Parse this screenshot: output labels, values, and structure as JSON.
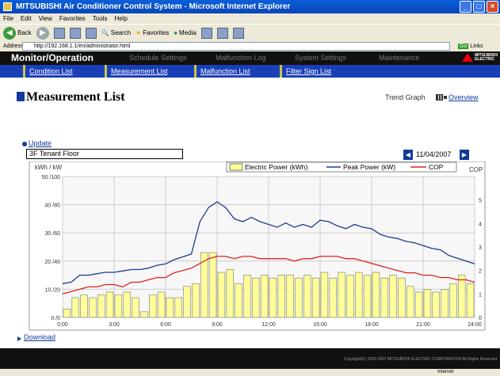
{
  "browser": {
    "title": "MITSUBISHI Air Conditioner Control System - Microsoft Internet Explorer",
    "menu": [
      "File",
      "Edit",
      "View",
      "Favorites",
      "Tools",
      "Help"
    ],
    "toolbar": {
      "back": "Back",
      "search": "Search",
      "favorites": "Favorites",
      "media": "Media"
    },
    "address_label": "Address",
    "address": "http://192.168.1.1/en/administrator.html",
    "go": "Go",
    "links": "Links",
    "status_zone": "Internet"
  },
  "nav": {
    "items": [
      "Monitor/Operation",
      "Schedule Settings",
      "Malfunction Log",
      "System Settings",
      "Maintenance"
    ]
  },
  "logo": {
    "line1": "MITSUBISHI",
    "line2": "ELECTRIC"
  },
  "subnav": {
    "items": [
      "Condition List",
      "Measurement List",
      "Malfunction List",
      "Filter Sign List"
    ]
  },
  "page": {
    "title": "Measurement List",
    "trend_label": "Trend Graph",
    "trend_link": "Overview",
    "update": "Update",
    "floor": "3F Tenant Floor",
    "date": "11/04/2007",
    "download": "Download",
    "copyright": "Copyright(C) 2002-2007 MITSUBISHI ELECTRIC CORPORATION All Rights Reserved"
  },
  "colors": {
    "bar_fill": "#ffff99",
    "bar_stroke": "#777777",
    "peak_line": "#1f3a93",
    "cop_line": "#e02020",
    "nav_bg": "#111111",
    "subnav_bg": "#1a3fb8"
  },
  "chart_data": {
    "type": "bar",
    "ylabel_left": "kWh / kW",
    "ylabel_right": "COP",
    "left_ticks": [
      "0 /0",
      "10 /20",
      "20 /40",
      "30 /60",
      "40 /80",
      "50 /100"
    ],
    "right_ticks": [
      "0",
      "1",
      "2",
      "3",
      "4",
      "5"
    ],
    "x_ticks": [
      "0:00",
      "3:00",
      "6:00",
      "9:00",
      "12:00",
      "15:00",
      "18:00",
      "21:00",
      "24:00"
    ],
    "legend": [
      "Electric Power (kWh)",
      "Peak Power (kW)",
      "COP"
    ],
    "ylim_energy": [
      0,
      50
    ],
    "ylim_power": [
      0,
      100
    ],
    "ylim_cop": [
      0,
      6
    ],
    "grid": true,
    "legend_position": "top",
    "series": [
      {
        "name": "Electric Power (kWh)",
        "type": "bar",
        "x": [
          0,
          1,
          2,
          3,
          4,
          5,
          6,
          7,
          8,
          9,
          10,
          11,
          12,
          13,
          14,
          15,
          16,
          17,
          18,
          19,
          20,
          21,
          22,
          23,
          24,
          25,
          26,
          27,
          28,
          29,
          30,
          31,
          32,
          33,
          34,
          35,
          36,
          37,
          38,
          39,
          40,
          41,
          42,
          43,
          44,
          45,
          46,
          47
        ],
        "values": [
          3,
          7,
          8,
          7,
          8,
          9,
          8,
          9,
          7,
          2,
          8,
          9,
          7,
          7,
          11,
          12,
          23,
          23,
          16,
          17,
          12,
          15,
          14,
          15,
          14,
          15,
          15,
          14,
          15,
          14,
          16,
          14,
          16,
          15,
          16,
          15,
          16,
          14,
          15,
          14,
          11,
          9,
          10,
          9,
          10,
          12,
          15,
          12
        ]
      },
      {
        "name": "Peak Power (kW)",
        "type": "line",
        "values": [
          24,
          25,
          30,
          30,
          31,
          32,
          32,
          33,
          34,
          34,
          35,
          37,
          38,
          41,
          43,
          45,
          68,
          78,
          82,
          78,
          70,
          68,
          71,
          68,
          66,
          64,
          67,
          64,
          66,
          64,
          69,
          68,
          65,
          63,
          66,
          64,
          63,
          59,
          57,
          56,
          54,
          53,
          51,
          49,
          48,
          44,
          42,
          40,
          38
        ]
      },
      {
        "name": "COP",
        "type": "line",
        "values": [
          1.0,
          1.1,
          1.2,
          1.3,
          1.3,
          1.4,
          1.4,
          1.3,
          1.5,
          1.5,
          1.6,
          1.7,
          1.7,
          1.9,
          2.0,
          2.1,
          2.3,
          2.5,
          2.6,
          2.6,
          2.5,
          2.6,
          2.6,
          2.5,
          2.5,
          2.5,
          2.5,
          2.4,
          2.5,
          2.5,
          2.6,
          2.6,
          2.6,
          2.5,
          2.5,
          2.4,
          2.3,
          2.2,
          2.1,
          2.0,
          1.9,
          1.9,
          1.8,
          1.8,
          1.7,
          1.7,
          1.6,
          1.6,
          1.5
        ]
      }
    ]
  }
}
